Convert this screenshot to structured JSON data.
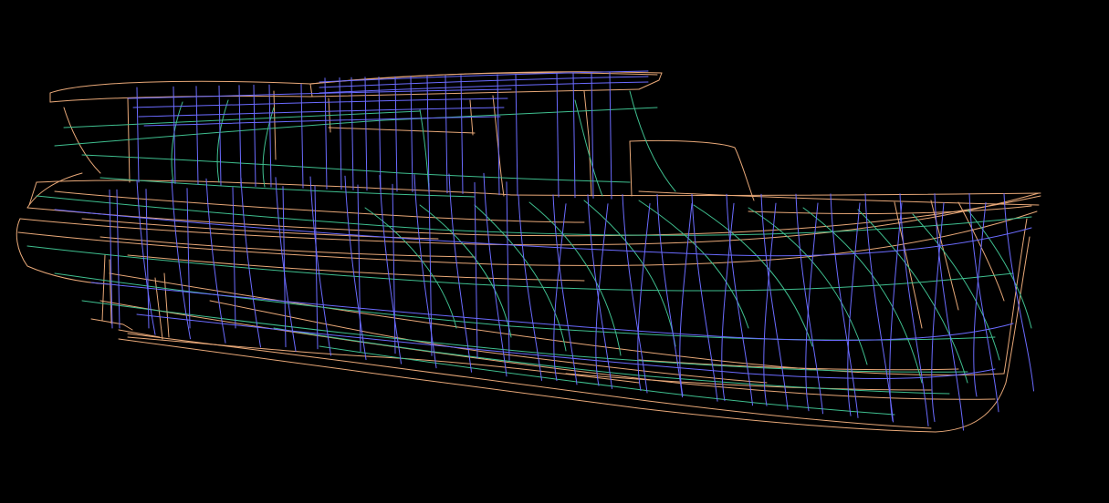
{
  "view": {
    "background": "#000000",
    "line_colors": {
      "waterline": "#e8a878",
      "station": "#6b6bff",
      "buttock": "#3fbf8f"
    }
  }
}
